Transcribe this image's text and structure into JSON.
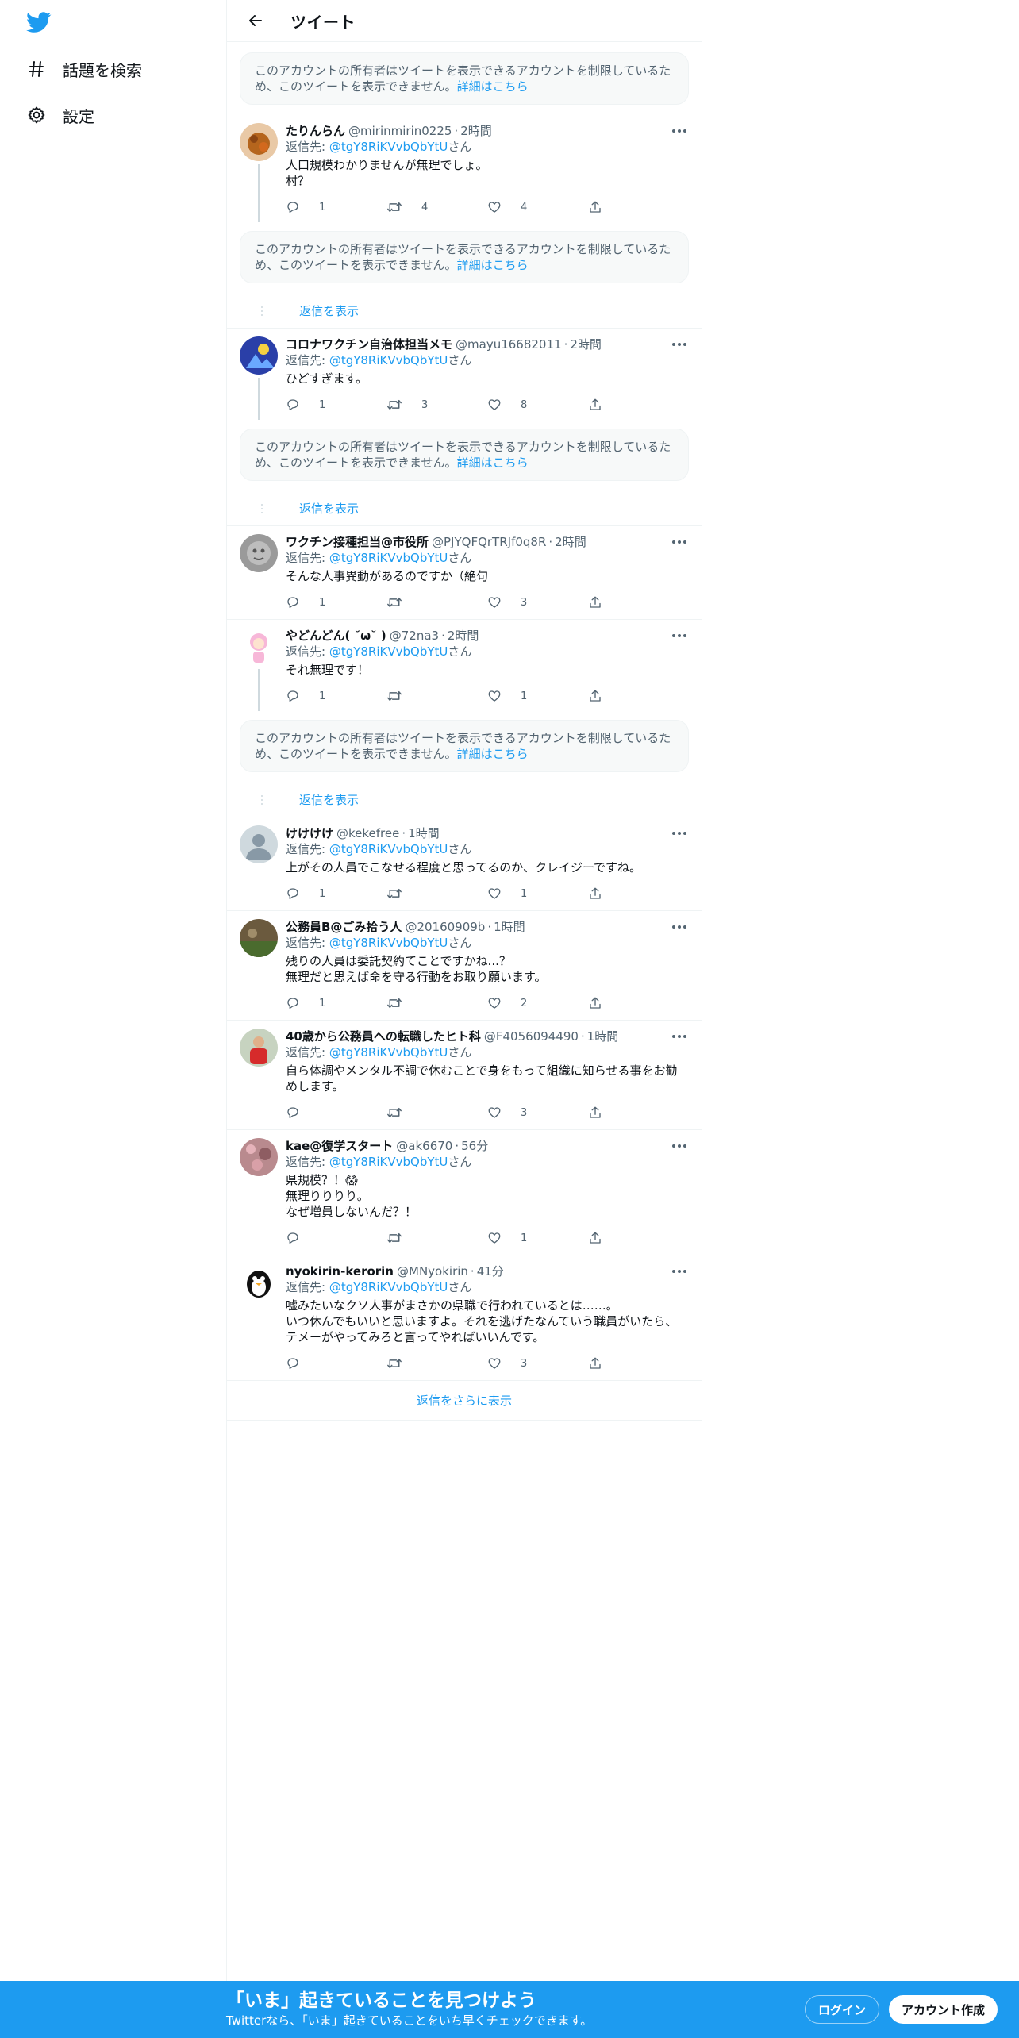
{
  "sidebar": {
    "logo_icon": "twitter-bird-icon",
    "explore_label": "話題を検索",
    "settings_label": "設定"
  },
  "header": {
    "title": "ツイート",
    "back_icon": "arrow-left-icon"
  },
  "restricted_notice": {
    "text": "このアカウントの所有者はツイートを表示できるアカウントを制限しているため、このツイートを表示できません。",
    "link": "詳細はこちら"
  },
  "reply_prefix": "返信先: ",
  "reply_suffix": "さん",
  "reply_target": "@tgY8RiKVvbQbYtU",
  "show_replies_label": "返信を表示",
  "show_more_label": "返信をさらに表示",
  "tweets": [
    {
      "name": "たりんらん",
      "handle": "@mirinmirin0225",
      "time": "2時間",
      "text": "人口規模わかりませんが無理でしょ。\n村？",
      "replies": "1",
      "retweets": "4",
      "likes": "4"
    },
    {
      "name": "コロナワクチン自治体担当メモ",
      "handle": "@mayu16682011",
      "time": "2時間",
      "text": "ひどすぎます。",
      "replies": "1",
      "retweets": "3",
      "likes": "8"
    },
    {
      "name": "ワクチン接種担当@市役所",
      "handle": "@PJYQFQrTRJf0q8R",
      "time": "2時間",
      "text": "そんな人事異動があるのですか（絶句",
      "replies": "1",
      "retweets": "",
      "likes": "3"
    },
    {
      "name": "やどんどん( ˘ω˘ )",
      "handle": "@72na3",
      "time": "2時間",
      "text": "それ無理です！",
      "replies": "1",
      "retweets": "",
      "likes": "1"
    },
    {
      "name": "けけけけ",
      "handle": "@kekefree",
      "time": "1時間",
      "text": "上がその人員でこなせる程度と思ってるのか、クレイジーですね。",
      "replies": "1",
      "retweets": "",
      "likes": "1"
    },
    {
      "name": "公務員B@ごみ拾う人",
      "handle": "@20160909b",
      "time": "1時間",
      "text": "残りの人員は委託契約てことですかね...？\n無理だと思えば命を守る行動をお取り願います。",
      "replies": "1",
      "retweets": "",
      "likes": "2"
    },
    {
      "name": "40歳から公務員への転職したヒト科",
      "handle": "@F4056094490",
      "time": "1時間",
      "text": "自ら体調やメンタル不調で休むことで身をもって組織に知らせる事をお勧めします。",
      "replies": "",
      "retweets": "",
      "likes": "3"
    },
    {
      "name": "kae@復学スタート",
      "handle": "@ak6670",
      "time": "56分",
      "text": "県規模？！😱\n無理りりりり。\nなぜ増員しないんだ？！",
      "replies": "",
      "retweets": "",
      "likes": "1"
    },
    {
      "name": "nyokirin-kerorin",
      "handle": "@MNyokirin",
      "time": "41分",
      "text": "嘘みたいなクソ人事がまさかの県職で行われているとは……。\nいつ休んでもいいと思いますよ。それを逃げたなんていう職員がいたら、テメーがやってみろと言ってやればいいんです。",
      "replies": "",
      "retweets": "",
      "likes": "3"
    }
  ],
  "banner": {
    "title": "「いま」起きていることを見つけよう",
    "subtitle": "Twitterなら、「いま」起きていることをいち早くチェックできます。",
    "login_label": "ログイン",
    "signup_label": "アカウント作成"
  },
  "colors": {
    "accent": "#1d9bf0",
    "text": "#0f1419",
    "muted": "#536471",
    "border": "#eff3f4"
  }
}
